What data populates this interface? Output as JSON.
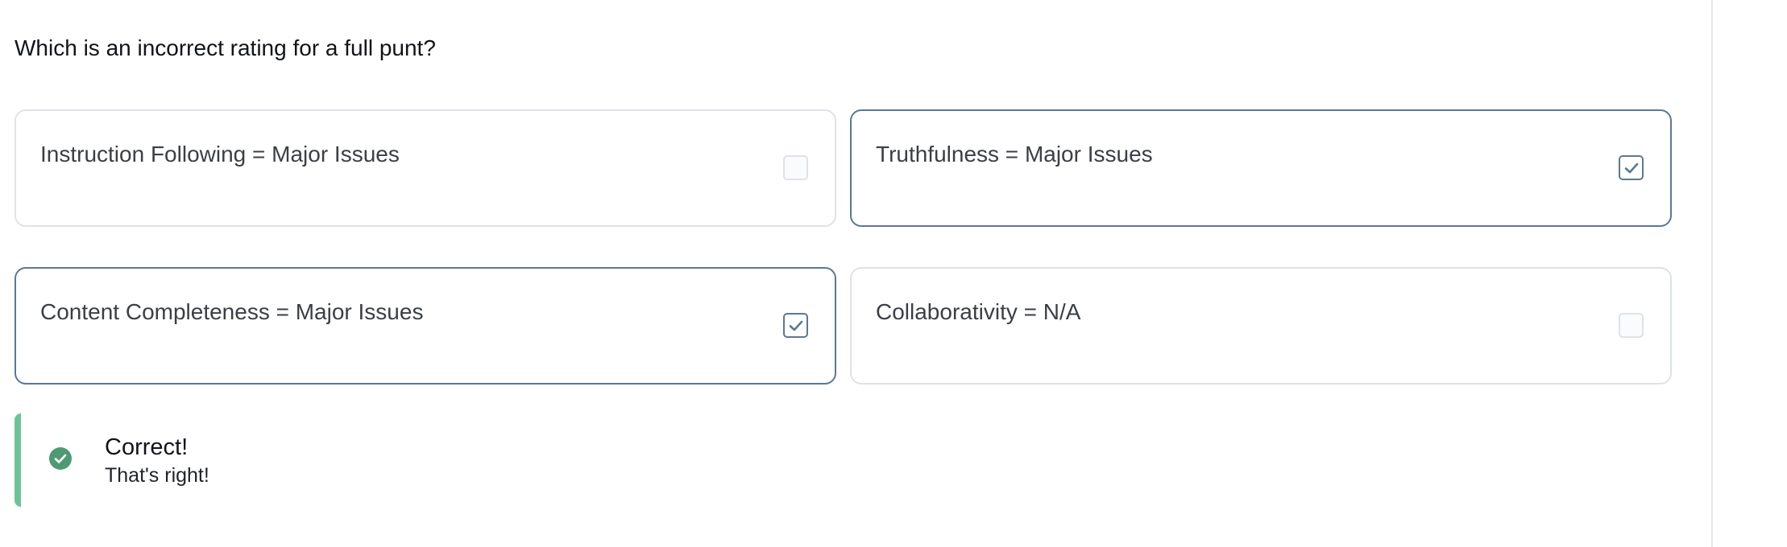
{
  "question": {
    "text": "Which is an incorrect rating for a full punt?"
  },
  "options": [
    {
      "label": "Instruction Following = Major Issues",
      "checked": false
    },
    {
      "label": "Truthfulness = Major Issues",
      "checked": true
    },
    {
      "label": "Content Completeness = Major Issues",
      "checked": true
    },
    {
      "label": "Collaborativity = N/A",
      "checked": false
    }
  ],
  "feedback": {
    "title": "Correct!",
    "message": "That's right!",
    "icon": "check-circle-icon",
    "accent_color": "#6cc495",
    "icon_color": "#4e9a72"
  },
  "colors": {
    "selected_border": "#5b7896",
    "unselected_border": "#dfe2e6"
  }
}
